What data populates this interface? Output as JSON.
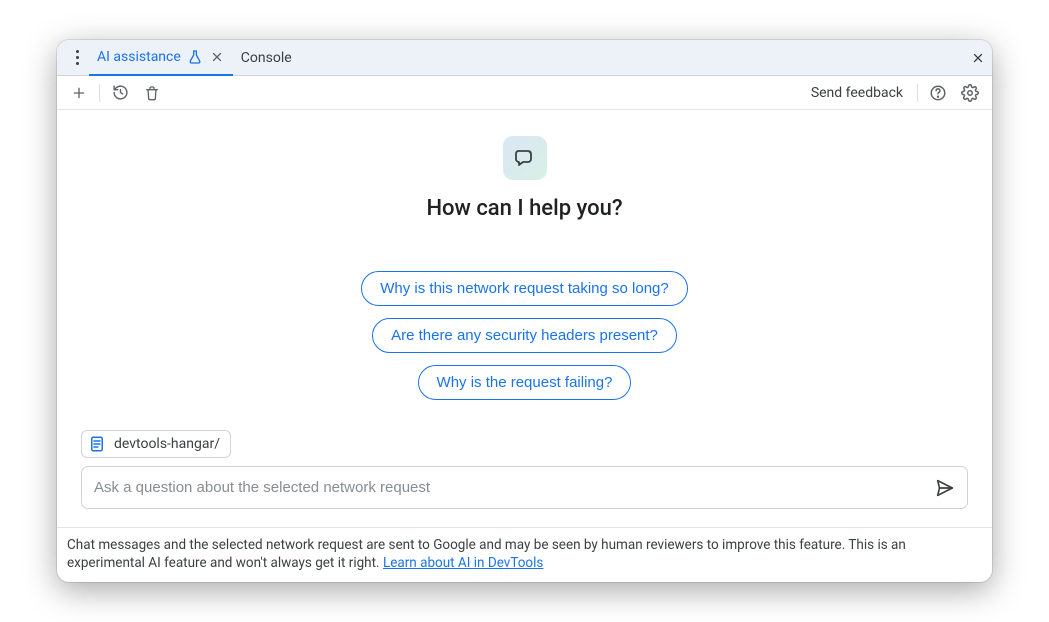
{
  "tabs": {
    "active": {
      "label": "AI assistance"
    },
    "other": {
      "label": "Console"
    }
  },
  "toolbar": {
    "send_feedback": "Send feedback"
  },
  "hero": {
    "headline": "How can I help you?"
  },
  "suggestions": [
    "Why is this network request taking so long?",
    "Are there any security headers present?",
    "Why is the request failing?"
  ],
  "context": {
    "label": "devtools-hangar/"
  },
  "input": {
    "placeholder": "Ask a question about the selected network request"
  },
  "footer": {
    "text": "Chat messages and the selected network request are sent to Google and may be seen by human reviewers to improve this feature. This is an experimental AI feature and won't always get it right. ",
    "link": "Learn about AI in DevTools"
  }
}
